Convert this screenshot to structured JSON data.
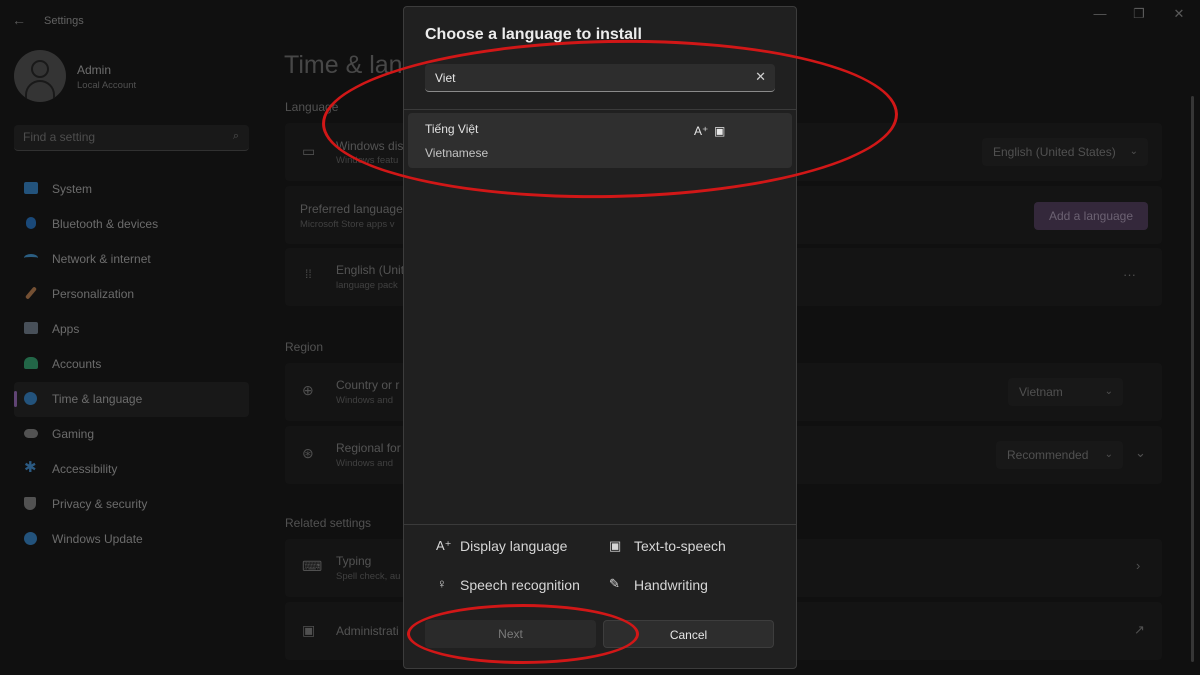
{
  "window": {
    "title": "Settings",
    "back_glyph": "←",
    "minimize_glyph": "—",
    "maximize_glyph": "❐",
    "close_glyph": "✕"
  },
  "user": {
    "name": "Admin",
    "type": "Local Account"
  },
  "search": {
    "placeholder": "Find a setting"
  },
  "sidebar": {
    "items": [
      {
        "label": "System",
        "icon": "system-icon",
        "color": "#3d8fd6"
      },
      {
        "label": "Bluetooth & devices",
        "icon": "bluetooth-icon",
        "color": "#2d7fd0"
      },
      {
        "label": "Network & internet",
        "icon": "wifi-icon",
        "color": "#4aa3e0"
      },
      {
        "label": "Personalization",
        "icon": "brush-icon",
        "color": "#c98a59"
      },
      {
        "label": "Apps",
        "icon": "apps-icon",
        "color": "#7d8b99"
      },
      {
        "label": "Accounts",
        "icon": "accounts-icon",
        "color": "#3bb07a"
      },
      {
        "label": "Time & language",
        "icon": "globe-clock-icon",
        "color": "#3d8fd6"
      },
      {
        "label": "Gaming",
        "icon": "gamepad-icon",
        "color": "#8e8e8e"
      },
      {
        "label": "Accessibility",
        "icon": "accessibility-icon",
        "color": "#4a9be0"
      },
      {
        "label": "Privacy & security",
        "icon": "shield-icon",
        "color": "#8e8e8e"
      },
      {
        "label": "Windows Update",
        "icon": "update-icon",
        "color": "#3d8fd6"
      }
    ],
    "active_index": 6,
    "accent": "#a576c8"
  },
  "main": {
    "title": "Time & lan",
    "language_section": "Language",
    "windows_display": {
      "title": "Windows dis",
      "subtitle": "Windows featu",
      "value": "English (United States)"
    },
    "preferred": {
      "title": "Preferred language",
      "subtitle": "Microsoft Store apps v",
      "button": "Add a language"
    },
    "english_entry": {
      "title": "English (Unit",
      "subtitle": "language pack",
      "more": "···"
    },
    "region_section": "Region",
    "country": {
      "title": "Country or r",
      "subtitle": "Windows and",
      "value": "Vietnam"
    },
    "regional_format": {
      "title": "Regional for",
      "subtitle": "Windows and",
      "value": "Recommended"
    },
    "related_section": "Related settings",
    "typing": {
      "title": "Typing",
      "subtitle": "Spell check, au"
    },
    "admin": {
      "title": "Administrati"
    }
  },
  "dialog": {
    "title": "Choose a language to install",
    "search_value": "Viet",
    "clear_glyph": "✕",
    "result": {
      "name": "Tiếng Việt",
      "english": "Vietnamese"
    },
    "features": [
      {
        "label": "Display language",
        "icon": "display-language-icon",
        "glyph": "A⁺"
      },
      {
        "label": "Text-to-speech",
        "icon": "text-to-speech-icon",
        "glyph": "🗨"
      },
      {
        "label": "Speech recognition",
        "icon": "microphone-icon",
        "glyph": "🎙"
      },
      {
        "label": "Handwriting",
        "icon": "handwriting-icon",
        "glyph": "✎"
      }
    ],
    "next_label": "Next",
    "cancel_label": "Cancel"
  },
  "annotation_color": "#d11717"
}
